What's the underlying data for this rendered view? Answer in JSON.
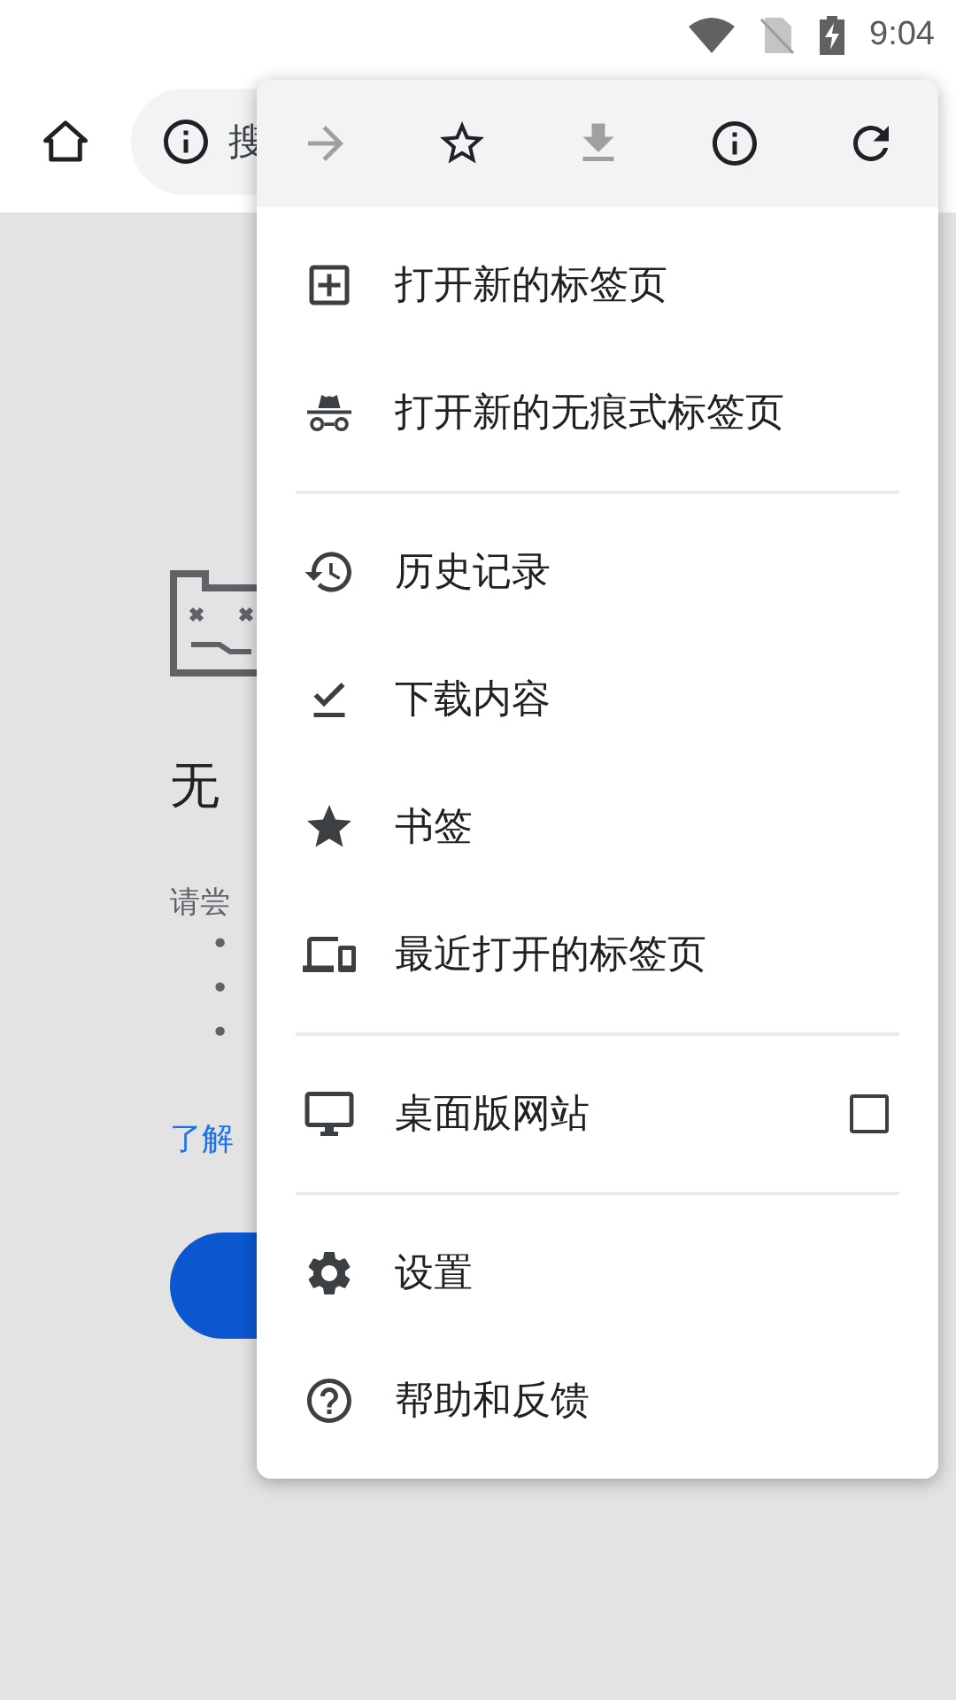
{
  "status_bar": {
    "time": "9:04"
  },
  "toolbar": {
    "omnibox_text": "搜"
  },
  "error_page": {
    "title": "无",
    "hint": "请尝",
    "bullets": [
      "•",
      "•",
      "•"
    ],
    "link": "了解"
  },
  "menu": {
    "top_actions": [
      {
        "kind": "forward",
        "disabled": true
      },
      {
        "kind": "bookmark",
        "disabled": false
      },
      {
        "kind": "download",
        "disabled": true
      },
      {
        "kind": "info",
        "disabled": false
      },
      {
        "kind": "reload",
        "disabled": false
      }
    ],
    "sections": [
      [
        {
          "kind": "new-tab",
          "label": "打开新的标签页"
        },
        {
          "kind": "incognito",
          "label": "打开新的无痕式标签页"
        }
      ],
      [
        {
          "kind": "history",
          "label": "历史记录"
        },
        {
          "kind": "downloads",
          "label": "下载内容"
        },
        {
          "kind": "bookmarks",
          "label": "书签"
        },
        {
          "kind": "recent-tabs",
          "label": "最近打开的标签页"
        }
      ],
      [
        {
          "kind": "desktop-site",
          "label": "桌面版网站",
          "checked": false
        }
      ],
      [
        {
          "kind": "settings",
          "label": "设置"
        },
        {
          "kind": "help",
          "label": "帮助和反馈"
        }
      ]
    ]
  }
}
